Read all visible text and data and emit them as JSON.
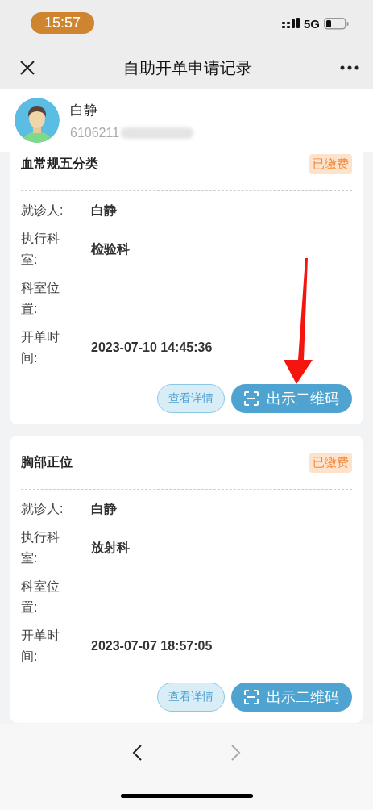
{
  "status_bar": {
    "time": "15:57",
    "network": "5G"
  },
  "nav": {
    "title": "自助开单申请记录"
  },
  "patient": {
    "name": "白静",
    "id_number": "6106211",
    "id_redacted": true
  },
  "orders": [
    {
      "title": "血常规五分类",
      "status": "已缴费",
      "fields": [
        {
          "label": "就诊人:",
          "value": "白静"
        },
        {
          "label": "执行科室:",
          "value": "检验科"
        },
        {
          "label": "科室位置:"
        },
        {
          "label": "开单时间:",
          "value": "2023-07-10 14:45:36"
        }
      ],
      "buttons": [
        {
          "label": "查看详情",
          "kind": "secondary"
        },
        {
          "label": "出示二维码",
          "kind": "primary"
        }
      ]
    },
    {
      "title": "胸部正位",
      "status": "已缴费",
      "fields": [
        {
          "label": "就诊人:",
          "value": "白静"
        },
        {
          "label": "执行科室:",
          "value": "放射科"
        },
        {
          "label": "科室位置:"
        },
        {
          "label": "开单时间:",
          "value": "2023-07-07 18:57:05"
        }
      ],
      "buttons": [
        {
          "label": "查看详情",
          "kind": "secondary"
        },
        {
          "label": "出示二维码",
          "kind": "primary"
        }
      ]
    }
  ],
  "annotation": {
    "kind": "arrow"
  },
  "toolbar": {
    "back_disabled": false,
    "forward_disabled": true
  }
}
